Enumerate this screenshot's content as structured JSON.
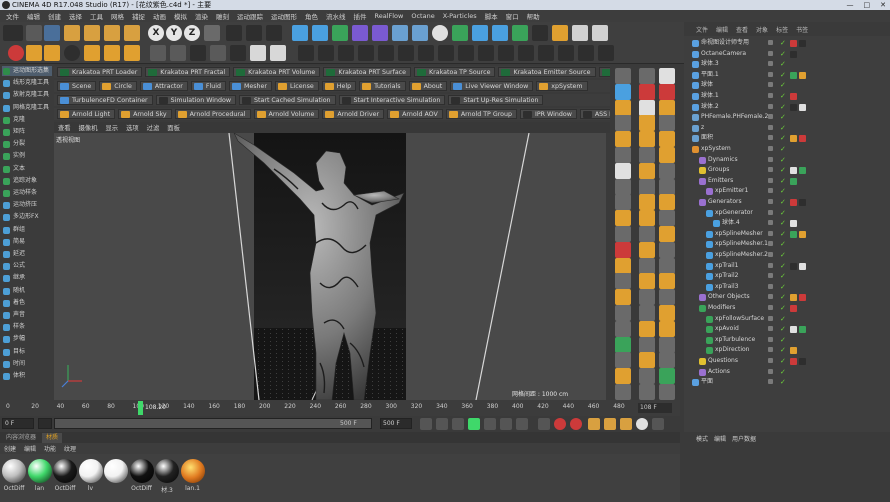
{
  "window": {
    "title": "CINEMA 4D R17.048 Studio (R17) - [花纹紫色.c4d *] - 主要",
    "controls": [
      "—",
      "□",
      "✕"
    ]
  },
  "menubar": [
    "文件",
    "编辑",
    "创建",
    "选择",
    "工具",
    "网格",
    "捕捉",
    "动画",
    "模拟",
    "渲染",
    "雕刻",
    "运动跟踪",
    "运动图形",
    "角色",
    "流水线",
    "插件",
    "RealFlow",
    "Octane",
    "X-Particles",
    "脚本",
    "窗口",
    "帮助"
  ],
  "xyz": [
    "X",
    "Y",
    "Z"
  ],
  "left_palette": [
    {
      "label": "运动图形选集",
      "color": "#2f8c4a",
      "selected": true
    },
    {
      "label": "线形克隆工具",
      "color": "#4d9fd6"
    },
    {
      "label": "放射克隆工具",
      "color": "#4d9fd6"
    },
    {
      "label": "网格克隆工具",
      "color": "#4d9fd6"
    },
    {
      "label": "克隆",
      "color": "#3aa35a"
    },
    {
      "label": "矩阵",
      "color": "#3aa35a"
    },
    {
      "label": "分裂",
      "color": "#3aa35a"
    },
    {
      "label": "实例",
      "color": "#3aa35a"
    },
    {
      "label": "文本",
      "color": "#3aa35a"
    },
    {
      "label": "追踪对象",
      "color": "#3aa35a"
    },
    {
      "label": "运动样条",
      "color": "#3aa35a"
    },
    {
      "label": "运动挤压",
      "color": "#4d9fd6"
    },
    {
      "label": "多边形FX",
      "color": "#4d9fd6"
    },
    {
      "label": "群组",
      "color": "#4d9fd6"
    },
    {
      "label": "简易",
      "color": "#4d9fd6"
    },
    {
      "label": "延迟",
      "color": "#4d9fd6"
    },
    {
      "label": "公式",
      "color": "#4d9fd6"
    },
    {
      "label": "继承",
      "color": "#4d9fd6"
    },
    {
      "label": "随机",
      "color": "#4d9fd6"
    },
    {
      "label": "着色",
      "color": "#4d9fd6"
    },
    {
      "label": "声音",
      "color": "#4d9fd6"
    },
    {
      "label": "样条",
      "color": "#4d9fd6"
    },
    {
      "label": "步幅",
      "color": "#4d9fd6"
    },
    {
      "label": "目标",
      "color": "#4d9fd6"
    },
    {
      "label": "时间",
      "color": "#4d9fd6"
    },
    {
      "label": "体积",
      "color": "#4d9fd6"
    }
  ],
  "plugin_rows": [
    [
      "Krakatoa PRT Loader",
      "Krakatoa PRT Fractal",
      "Krakatoa PRT Volume",
      "Krakatoa PRT Surface",
      "Krakatoa TP Source",
      "Krakatoa Emitter Source",
      "Krakatoa X-Particles Source"
    ],
    [
      "Scene",
      "Circle",
      "Attractor",
      "Fluid",
      "Mesher",
      "License",
      "Help",
      "Tutorials",
      "About",
      "Live Viewer Window",
      "xpSystem"
    ],
    [
      "TurbulenceFD Container",
      "Simulation Window",
      "Start Cached Simulation",
      "Start Interactive Simulation",
      "Start Up-Res Simulation"
    ],
    [
      "Arnold Light",
      "Arnold Sky",
      "Arnold Procedural",
      "Arnold Volume",
      "Arnold Driver",
      "Arnold AOV",
      "Arnold TP Group",
      "IPR Window",
      "ASS Export",
      "Asset/Tx Manager"
    ]
  ],
  "viewport_menu": [
    "查看",
    "摄像机",
    "显示",
    "选项",
    "过滤",
    "面板"
  ],
  "viewport": {
    "label": "透视视图",
    "grid_label": "网格间距 : 1000 cm"
  },
  "timeline": {
    "ticks": [
      "0",
      "20",
      "40",
      "60",
      "80",
      "100",
      "120",
      "140",
      "160",
      "180",
      "200",
      "220",
      "240",
      "260",
      "280",
      "300",
      "320",
      "340",
      "360",
      "380",
      "400",
      "420",
      "440",
      "460",
      "480",
      "500"
    ],
    "current": "108.20",
    "frame_box": "108 F"
  },
  "transport": {
    "start": "0 F",
    "current": "0 F",
    "end": "500 F",
    "end2": "500 F"
  },
  "mat_tabs": [
    "内容浏览器",
    "材质"
  ],
  "mat_menu": [
    "创建",
    "编辑",
    "功能",
    "纹理"
  ],
  "materials": [
    {
      "label": "OctDiff",
      "color": "#bfbfbf"
    },
    {
      "label": "lan",
      "color": "#3fd86a"
    },
    {
      "label": "OctDiff",
      "color": "#1a1a1a"
    },
    {
      "label": "lv",
      "color": "#f2f2f2"
    },
    {
      "label": "",
      "color": "#f2f2f2"
    },
    {
      "label": "OctDiff",
      "color": "#111111"
    },
    {
      "label": "材.3",
      "color": "#222222"
    },
    {
      "label": "lan.1",
      "color": "#f0a030"
    }
  ],
  "obj_menu": [
    "文件",
    "编辑",
    "查看",
    "对象",
    "标签",
    "书签"
  ],
  "objects": [
    {
      "name": "命视图设计师专用",
      "indent": 0,
      "icon": "#5aa0e0"
    },
    {
      "name": "OctaneCamera",
      "indent": 0,
      "icon": "#5aa0e0"
    },
    {
      "name": "球体.3",
      "indent": 0,
      "icon": "#5aa0e0"
    },
    {
      "name": "平面.1",
      "indent": 0,
      "icon": "#5aa0e0"
    },
    {
      "name": "球体",
      "indent": 0,
      "icon": "#5aa0e0"
    },
    {
      "name": "球体.1",
      "indent": 0,
      "icon": "#5aa0e0"
    },
    {
      "name": "球体.2",
      "indent": 0,
      "icon": "#5aa0e0"
    },
    {
      "name": "PHFemale.PHFemale.2",
      "indent": 0,
      "icon": "#6aa0d0"
    },
    {
      "name": "z",
      "indent": 0,
      "icon": "#6aa0d0"
    },
    {
      "name": "面积",
      "indent": 0,
      "icon": "#6aa0d0"
    },
    {
      "name": "xpSystem",
      "indent": 0,
      "icon": "#e09030"
    },
    {
      "name": "Dynamics",
      "indent": 1,
      "icon": "#9a70d0"
    },
    {
      "name": "Groups",
      "indent": 1,
      "icon": "#e0c030"
    },
    {
      "name": "Emitters",
      "indent": 1,
      "icon": "#9a70d0"
    },
    {
      "name": "xpEmitter1",
      "indent": 2,
      "icon": "#9a70d0"
    },
    {
      "name": "Generators",
      "indent": 1,
      "icon": "#9a70d0"
    },
    {
      "name": "xpGenerator",
      "indent": 2,
      "icon": "#4aa0e0"
    },
    {
      "name": "球体.4",
      "indent": 3,
      "icon": "#4aa0e0"
    },
    {
      "name": "xpSplineMesher",
      "indent": 2,
      "icon": "#4aa0e0"
    },
    {
      "name": "xpSplineMesher.1",
      "indent": 2,
      "icon": "#4aa0e0"
    },
    {
      "name": "xpSplineMesher.2",
      "indent": 2,
      "icon": "#4aa0e0"
    },
    {
      "name": "xpTrail1",
      "indent": 2,
      "icon": "#4aa0e0"
    },
    {
      "name": "xpTrail2",
      "indent": 2,
      "icon": "#4aa0e0"
    },
    {
      "name": "xpTrail3",
      "indent": 2,
      "icon": "#4aa0e0"
    },
    {
      "name": "Other Objects",
      "indent": 1,
      "icon": "#9a70d0"
    },
    {
      "name": "Modifiers",
      "indent": 1,
      "icon": "#3aa35a"
    },
    {
      "name": "xpFollowSurface",
      "indent": 2,
      "icon": "#3aa35a"
    },
    {
      "name": "xpAvoid",
      "indent": 2,
      "icon": "#3aa35a"
    },
    {
      "name": "xpTurbulence",
      "indent": 2,
      "icon": "#3aa35a"
    },
    {
      "name": "xpDirection",
      "indent": 2,
      "icon": "#3aa35a"
    },
    {
      "name": "Questions",
      "indent": 1,
      "icon": "#e0c030"
    },
    {
      "name": "Actions",
      "indent": 1,
      "icon": "#9a70d0"
    },
    {
      "name": "平面",
      "indent": 0,
      "icon": "#5aa0e0"
    }
  ],
  "attr_menu": [
    "模式",
    "编辑",
    "用户数据"
  ]
}
